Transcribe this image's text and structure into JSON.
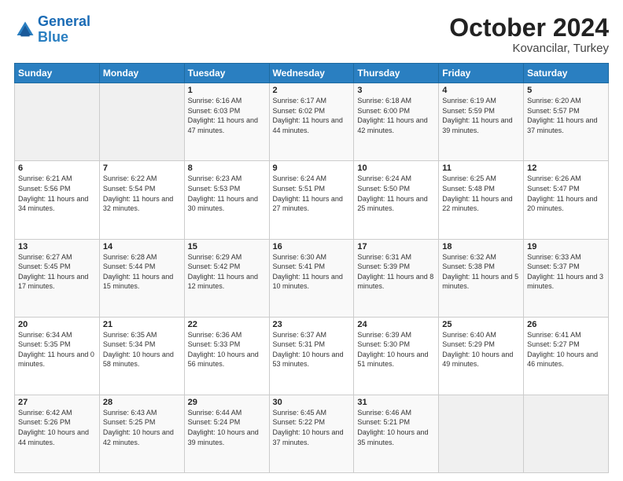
{
  "header": {
    "logo_line1": "General",
    "logo_line2": "Blue",
    "month": "October 2024",
    "location": "Kovancilar, Turkey"
  },
  "columns": [
    "Sunday",
    "Monday",
    "Tuesday",
    "Wednesday",
    "Thursday",
    "Friday",
    "Saturday"
  ],
  "weeks": [
    [
      {
        "day": "",
        "info": ""
      },
      {
        "day": "",
        "info": ""
      },
      {
        "day": "1",
        "info": "Sunrise: 6:16 AM\nSunset: 6:03 PM\nDaylight: 11 hours and 47 minutes."
      },
      {
        "day": "2",
        "info": "Sunrise: 6:17 AM\nSunset: 6:02 PM\nDaylight: 11 hours and 44 minutes."
      },
      {
        "day": "3",
        "info": "Sunrise: 6:18 AM\nSunset: 6:00 PM\nDaylight: 11 hours and 42 minutes."
      },
      {
        "day": "4",
        "info": "Sunrise: 6:19 AM\nSunset: 5:59 PM\nDaylight: 11 hours and 39 minutes."
      },
      {
        "day": "5",
        "info": "Sunrise: 6:20 AM\nSunset: 5:57 PM\nDaylight: 11 hours and 37 minutes."
      }
    ],
    [
      {
        "day": "6",
        "info": "Sunrise: 6:21 AM\nSunset: 5:56 PM\nDaylight: 11 hours and 34 minutes."
      },
      {
        "day": "7",
        "info": "Sunrise: 6:22 AM\nSunset: 5:54 PM\nDaylight: 11 hours and 32 minutes."
      },
      {
        "day": "8",
        "info": "Sunrise: 6:23 AM\nSunset: 5:53 PM\nDaylight: 11 hours and 30 minutes."
      },
      {
        "day": "9",
        "info": "Sunrise: 6:24 AM\nSunset: 5:51 PM\nDaylight: 11 hours and 27 minutes."
      },
      {
        "day": "10",
        "info": "Sunrise: 6:24 AM\nSunset: 5:50 PM\nDaylight: 11 hours and 25 minutes."
      },
      {
        "day": "11",
        "info": "Sunrise: 6:25 AM\nSunset: 5:48 PM\nDaylight: 11 hours and 22 minutes."
      },
      {
        "day": "12",
        "info": "Sunrise: 6:26 AM\nSunset: 5:47 PM\nDaylight: 11 hours and 20 minutes."
      }
    ],
    [
      {
        "day": "13",
        "info": "Sunrise: 6:27 AM\nSunset: 5:45 PM\nDaylight: 11 hours and 17 minutes."
      },
      {
        "day": "14",
        "info": "Sunrise: 6:28 AM\nSunset: 5:44 PM\nDaylight: 11 hours and 15 minutes."
      },
      {
        "day": "15",
        "info": "Sunrise: 6:29 AM\nSunset: 5:42 PM\nDaylight: 11 hours and 12 minutes."
      },
      {
        "day": "16",
        "info": "Sunrise: 6:30 AM\nSunset: 5:41 PM\nDaylight: 11 hours and 10 minutes."
      },
      {
        "day": "17",
        "info": "Sunrise: 6:31 AM\nSunset: 5:39 PM\nDaylight: 11 hours and 8 minutes."
      },
      {
        "day": "18",
        "info": "Sunrise: 6:32 AM\nSunset: 5:38 PM\nDaylight: 11 hours and 5 minutes."
      },
      {
        "day": "19",
        "info": "Sunrise: 6:33 AM\nSunset: 5:37 PM\nDaylight: 11 hours and 3 minutes."
      }
    ],
    [
      {
        "day": "20",
        "info": "Sunrise: 6:34 AM\nSunset: 5:35 PM\nDaylight: 11 hours and 0 minutes."
      },
      {
        "day": "21",
        "info": "Sunrise: 6:35 AM\nSunset: 5:34 PM\nDaylight: 10 hours and 58 minutes."
      },
      {
        "day": "22",
        "info": "Sunrise: 6:36 AM\nSunset: 5:33 PM\nDaylight: 10 hours and 56 minutes."
      },
      {
        "day": "23",
        "info": "Sunrise: 6:37 AM\nSunset: 5:31 PM\nDaylight: 10 hours and 53 minutes."
      },
      {
        "day": "24",
        "info": "Sunrise: 6:39 AM\nSunset: 5:30 PM\nDaylight: 10 hours and 51 minutes."
      },
      {
        "day": "25",
        "info": "Sunrise: 6:40 AM\nSunset: 5:29 PM\nDaylight: 10 hours and 49 minutes."
      },
      {
        "day": "26",
        "info": "Sunrise: 6:41 AM\nSunset: 5:27 PM\nDaylight: 10 hours and 46 minutes."
      }
    ],
    [
      {
        "day": "27",
        "info": "Sunrise: 6:42 AM\nSunset: 5:26 PM\nDaylight: 10 hours and 44 minutes."
      },
      {
        "day": "28",
        "info": "Sunrise: 6:43 AM\nSunset: 5:25 PM\nDaylight: 10 hours and 42 minutes."
      },
      {
        "day": "29",
        "info": "Sunrise: 6:44 AM\nSunset: 5:24 PM\nDaylight: 10 hours and 39 minutes."
      },
      {
        "day": "30",
        "info": "Sunrise: 6:45 AM\nSunset: 5:22 PM\nDaylight: 10 hours and 37 minutes."
      },
      {
        "day": "31",
        "info": "Sunrise: 6:46 AM\nSunset: 5:21 PM\nDaylight: 10 hours and 35 minutes."
      },
      {
        "day": "",
        "info": ""
      },
      {
        "day": "",
        "info": ""
      }
    ]
  ]
}
